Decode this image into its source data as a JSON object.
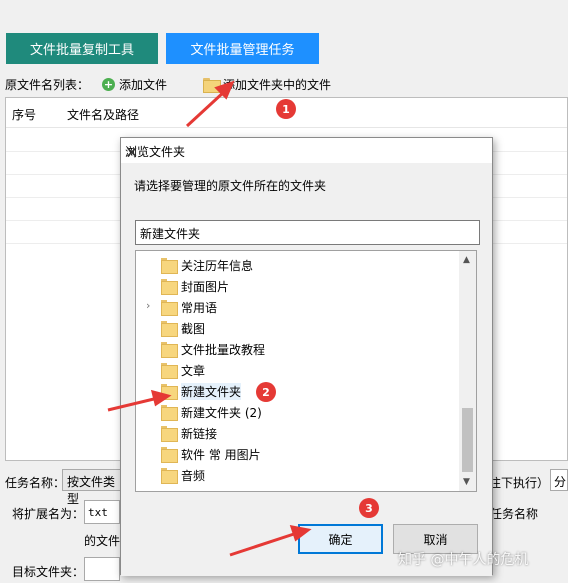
{
  "tabs": {
    "copy_tool": "文件批量复制工具",
    "manage_task": "文件批量管理任务"
  },
  "toolbar": {
    "list_label": "原文件名列表：",
    "add_file": "添加文件",
    "add_folder_files": "添加文件夹中的文件"
  },
  "file_list": {
    "columns": [
      "序号",
      "文件名及路径"
    ]
  },
  "bottom": {
    "task_name_label": "任务名称：",
    "task_name_value": "按文件类型",
    "exec_hint": "往下执行）",
    "split_hint": "分",
    "ext_label": "将扩展名为：",
    "ext_value": "txt",
    "task_name_right": "任务名称",
    "file_label": "的文件",
    "target_label": "目标文件夹："
  },
  "dialog": {
    "title": "浏览文件夹",
    "instruction": "请选择要管理的原文件所在的文件夹",
    "path_value": "新建文件夹",
    "folders": [
      {
        "name": "关注历年信息",
        "expandable": false,
        "selected": false
      },
      {
        "name": "封面图片",
        "expandable": false,
        "selected": false
      },
      {
        "name": "常用语",
        "expandable": true,
        "selected": false
      },
      {
        "name": "截图",
        "expandable": false,
        "selected": false
      },
      {
        "name": "文件批量改教程",
        "expandable": false,
        "selected": false
      },
      {
        "name": "文章",
        "expandable": false,
        "selected": false
      },
      {
        "name": "新建文件夹",
        "expandable": false,
        "selected": true
      },
      {
        "name": "新建文件夹 (2)",
        "expandable": false,
        "selected": false
      },
      {
        "name": "新链接",
        "expandable": false,
        "selected": false
      },
      {
        "name": "软件 常 用图片",
        "expandable": false,
        "selected": false
      },
      {
        "name": "音频",
        "expandable": false,
        "selected": false
      }
    ],
    "ok_label": "确定",
    "cancel_label": "取消"
  },
  "annotations": {
    "marker1": "1",
    "marker2": "2",
    "marker3": "3",
    "arrow_color": "#e53935"
  },
  "watermark": "知乎 @中午人的危机"
}
